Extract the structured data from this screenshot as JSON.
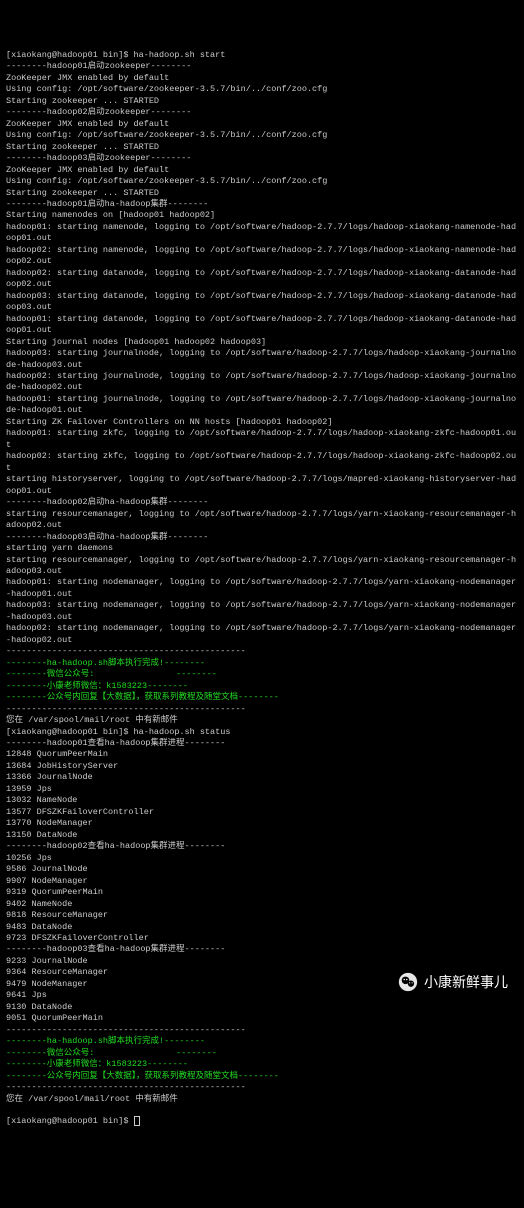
{
  "terminal_lines": [
    "[xiaokang@hadoop01 bin]$ ha-hadoop.sh start",
    "--------hadoop01启动zookeeper--------",
    "ZooKeeper JMX enabled by default",
    "Using config: /opt/software/zookeeper-3.5.7/bin/../conf/zoo.cfg",
    "Starting zookeeper ... STARTED",
    "--------hadoop02启动zookeeper--------",
    "ZooKeeper JMX enabled by default",
    "Using config: /opt/software/zookeeper-3.5.7/bin/../conf/zoo.cfg",
    "Starting zookeeper ... STARTED",
    "--------hadoop03启动zookeeper--------",
    "ZooKeeper JMX enabled by default",
    "Using config: /opt/software/zookeeper-3.5.7/bin/../conf/zoo.cfg",
    "Starting zookeeper ... STARTED",
    "--------hadoop01启动ha-hadoop集群--------",
    "Starting namenodes on [hadoop01 hadoop02]",
    "hadoop01: starting namenode, logging to /opt/software/hadoop-2.7.7/logs/hadoop-xiaokang-namenode-hadoop01.out",
    "hadoop02: starting namenode, logging to /opt/software/hadoop-2.7.7/logs/hadoop-xiaokang-namenode-hadoop02.out",
    "hadoop02: starting datanode, logging to /opt/software/hadoop-2.7.7/logs/hadoop-xiaokang-datanode-hadoop02.out",
    "hadoop03: starting datanode, logging to /opt/software/hadoop-2.7.7/logs/hadoop-xiaokang-datanode-hadoop03.out",
    "hadoop01: starting datanode, logging to /opt/software/hadoop-2.7.7/logs/hadoop-xiaokang-datanode-hadoop01.out",
    "Starting journal nodes [hadoop01 hadoop02 hadoop03]",
    "hadoop03: starting journalnode, logging to /opt/software/hadoop-2.7.7/logs/hadoop-xiaokang-journalnode-hadoop03.out",
    "hadoop02: starting journalnode, logging to /opt/software/hadoop-2.7.7/logs/hadoop-xiaokang-journalnode-hadoop02.out",
    "hadoop01: starting journalnode, logging to /opt/software/hadoop-2.7.7/logs/hadoop-xiaokang-journalnode-hadoop01.out",
    "Starting ZK Failover Controllers on NN hosts [hadoop01 hadoop02]",
    "hadoop01: starting zkfc, logging to /opt/software/hadoop-2.7.7/logs/hadoop-xiaokang-zkfc-hadoop01.out",
    "hadoop02: starting zkfc, logging to /opt/software/hadoop-2.7.7/logs/hadoop-xiaokang-zkfc-hadoop02.out",
    "starting historyserver, logging to /opt/software/hadoop-2.7.7/logs/mapred-xiaokang-historyserver-hadoop01.out",
    "--------hadoop02启动ha-hadoop集群--------",
    "starting resourcemanager, logging to /opt/software/hadoop-2.7.7/logs/yarn-xiaokang-resourcemanager-hadoop02.out",
    "--------hadoop03启动ha-hadoop集群--------",
    "starting yarn daemons",
    "starting resourcemanager, logging to /opt/software/hadoop-2.7.7/logs/yarn-xiaokang-resourcemanager-hadoop03.out",
    "hadoop01: starting nodemanager, logging to /opt/software/hadoop-2.7.7/logs/yarn-xiaokang-nodemanager-hadoop01.out",
    "hadoop03: starting nodemanager, logging to /opt/software/hadoop-2.7.7/logs/yarn-xiaokang-nodemanager-hadoop03.out",
    "hadoop02: starting nodemanager, logging to /opt/software/hadoop-2.7.7/logs/yarn-xiaokang-nodemanager-hadoop02.out",
    "-----------------------------------------------",
    {
      "text": "--------ha-hadoop.sh脚本执行完成!--------",
      "highlight": true
    },
    {
      "text": "--------微信公众号:                --------",
      "highlight": true
    },
    {
      "text": "--------小康老师微信：k1583223--------",
      "highlight": true
    },
    {
      "text": "--------公众号内回复【大数据】，获取系列教程及随堂文档--------",
      "highlight": true
    },
    "-----------------------------------------------",
    "您在 /var/spool/mail/root 中有新邮件",
    "[xiaokang@hadoop01 bin]$ ha-hadoop.sh status",
    "--------hadoop01查看ha-hadoop集群进程--------",
    "12848 QuorumPeerMain",
    "13684 JobHistoryServer",
    "13366 JournalNode",
    "13959 Jps",
    "13032 NameNode",
    "13577 DFSZKFailoverController",
    "13770 NodeManager",
    "13150 DataNode",
    "--------hadoop02查看ha-hadoop集群进程--------",
    "10256 Jps",
    "9586 JournalNode",
    "9907 NodeManager",
    "9319 QuorumPeerMain",
    "9402 NameNode",
    "9818 ResourceManager",
    "9483 DataNode",
    "9723 DFSZKFailoverController",
    "--------hadoop03查看ha-hadoop集群进程--------",
    "9233 JournalNode",
    "9364 ResourceManager",
    "9479 NodeManager",
    "9641 Jps",
    "9130 DataNode",
    "9051 QuorumPeerMain",
    "-----------------------------------------------",
    {
      "text": "--------ha-hadoop.sh脚本执行完成!--------",
      "highlight": true
    },
    {
      "text": "--------微信公众号:                --------",
      "highlight": true
    },
    {
      "text": "--------小康老师微信：k1583223--------",
      "highlight": true
    },
    {
      "text": "--------公众号内回复【大数据】，获取系列教程及随堂文档--------",
      "highlight": true
    },
    "-----------------------------------------------",
    "您在 /var/spool/mail/root 中有新邮件"
  ],
  "final_prompt": "[xiaokang@hadoop01 bin]$ ",
  "watermark_text": "小康新鲜事儿"
}
